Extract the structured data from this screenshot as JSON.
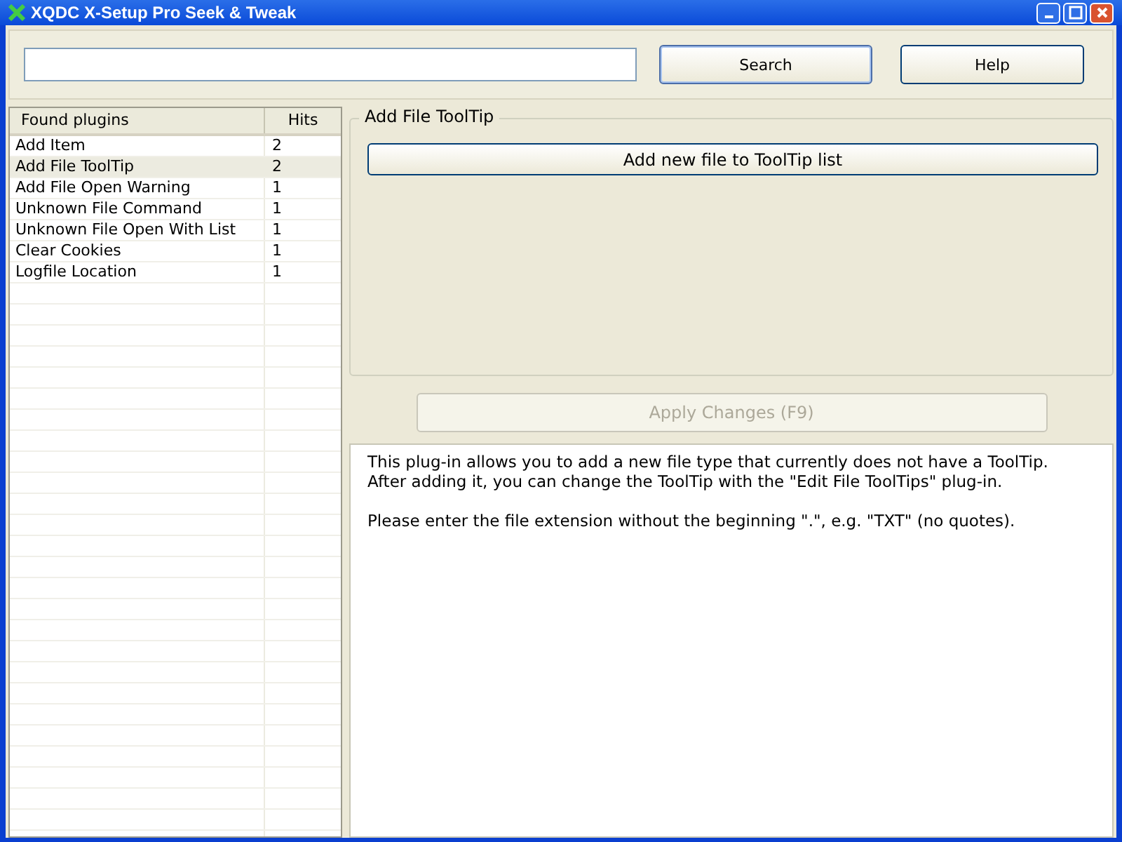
{
  "window": {
    "title": "XQDC X-Setup Pro Seek & Tweak"
  },
  "search": {
    "button": "Search",
    "help": "Help"
  },
  "plugins": {
    "columns": [
      "Found plugins",
      "Hits"
    ],
    "rows": [
      {
        "name": "Add Item",
        "hits": "2",
        "selected": false
      },
      {
        "name": "Add File ToolTip",
        "hits": "2",
        "selected": true
      },
      {
        "name": "Add File Open Warning",
        "hits": "1",
        "selected": false
      },
      {
        "name": "Unknown File Command",
        "hits": "1",
        "selected": false
      },
      {
        "name": "Unknown File Open With List",
        "hits": "1",
        "selected": false
      },
      {
        "name": "Clear Cookies",
        "hits": "1",
        "selected": false
      },
      {
        "name": "Logfile Location",
        "hits": "1",
        "selected": false
      }
    ]
  },
  "plugin_panel": {
    "title": "Add File ToolTip",
    "action": "Add new file to ToolTip list"
  },
  "apply": {
    "label": "Apply Changes (F9)",
    "disabled": true
  },
  "description": [
    [
      "This plug-in allows you to add a new file type that currently does not have a ToolTip.",
      "After adding it, you can change the ToolTip with the \"Edit File ToolTips\" plug-in."
    ],
    [
      "Please enter the file extension without the beginning \".\", e.g. \"TXT\" (no quotes)."
    ]
  ]
}
